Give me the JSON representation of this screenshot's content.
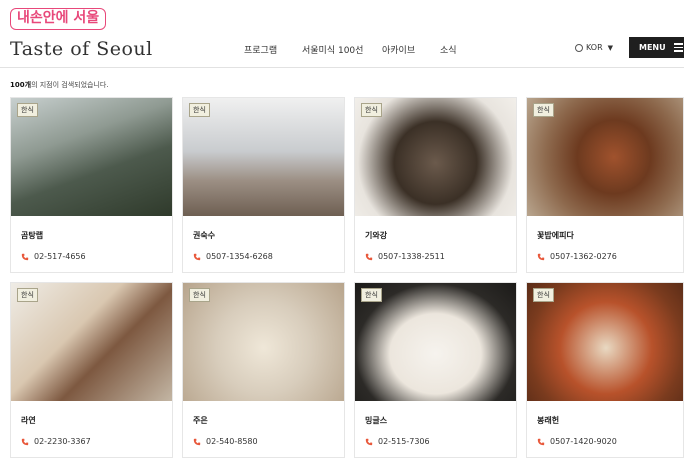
{
  "badge": "내손안에 서울",
  "header": {
    "logo_text": "Taste of Seoul",
    "logo_dot_colors": [
      "#3fa65a",
      "#e8487a",
      "#f0b323"
    ],
    "nav": [
      "프로그램",
      "서울미식 100선",
      "아카이브",
      "소식"
    ],
    "language": "KOR",
    "menu_label": "MENU"
  },
  "result": {
    "count": "100개",
    "text": "의 지점이 검색되었습니다."
  },
  "accent_color": "#e8573a",
  "restaurants": [
    {
      "tag": "한식",
      "name": "곰탕랩",
      "phone": "02-517-4656"
    },
    {
      "tag": "한식",
      "name": "권숙수",
      "phone": "0507-1354-6268"
    },
    {
      "tag": "한식",
      "name": "기와강",
      "phone": "0507-1338-2511"
    },
    {
      "tag": "한식",
      "name": "꽃밥에피다",
      "phone": "0507-1362-0276"
    },
    {
      "tag": "한식",
      "name": "라연",
      "phone": "02-2230-3367"
    },
    {
      "tag": "한식",
      "name": "주은",
      "phone": "02-540-8580"
    },
    {
      "tag": "한식",
      "name": "밍글스",
      "phone": "02-515-7306"
    },
    {
      "tag": "한식",
      "name": "봉래헌",
      "phone": "0507-1420-9020"
    }
  ]
}
